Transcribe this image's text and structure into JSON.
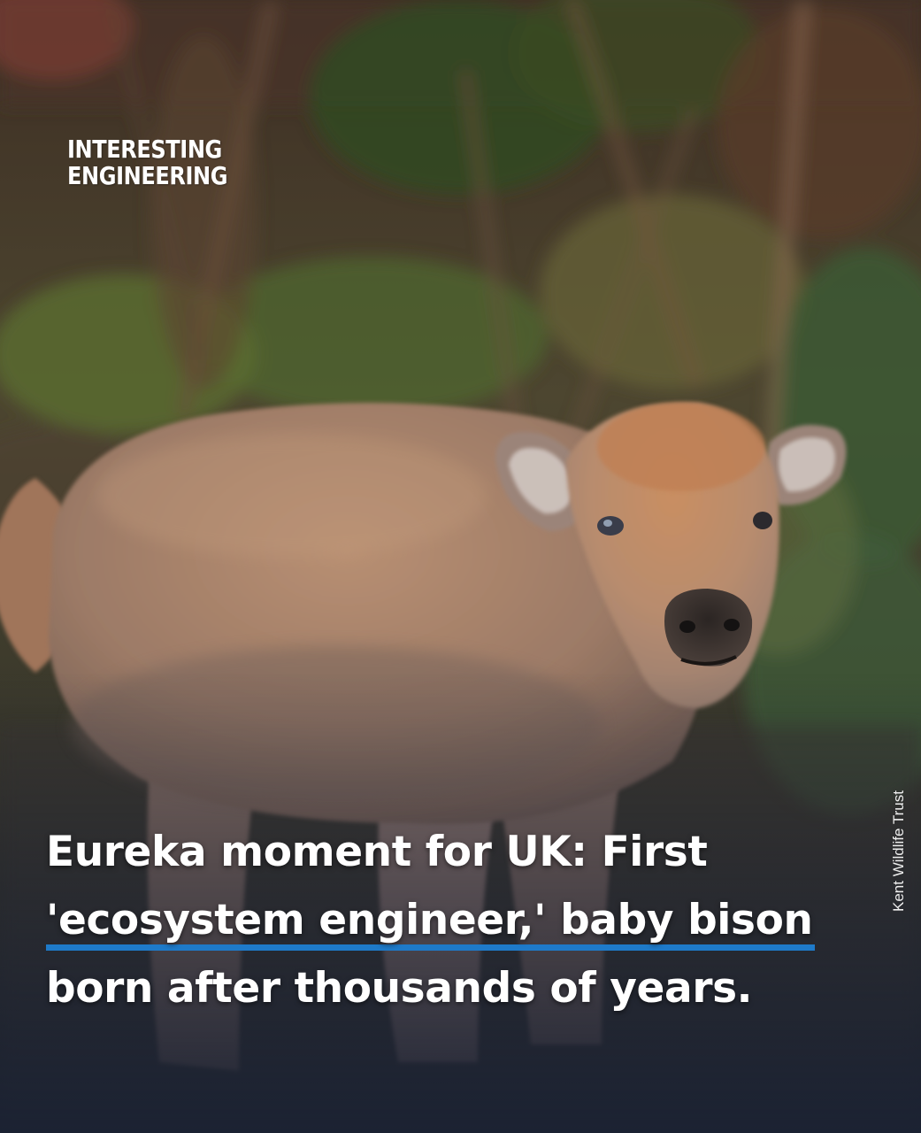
{
  "logo": {
    "line1": "INTERESTING",
    "line2": "ENGINEERING"
  },
  "credit": "Kent Wildlife Trust",
  "headline": {
    "line1": "Eureka moment for UK: First",
    "line2": "'ecosystem engineer,' baby bison",
    "line3": "born after thousands of years."
  },
  "colors": {
    "underline": "#1e7ac9",
    "text": "#ffffff",
    "bottom_fade": "#1b2233"
  }
}
